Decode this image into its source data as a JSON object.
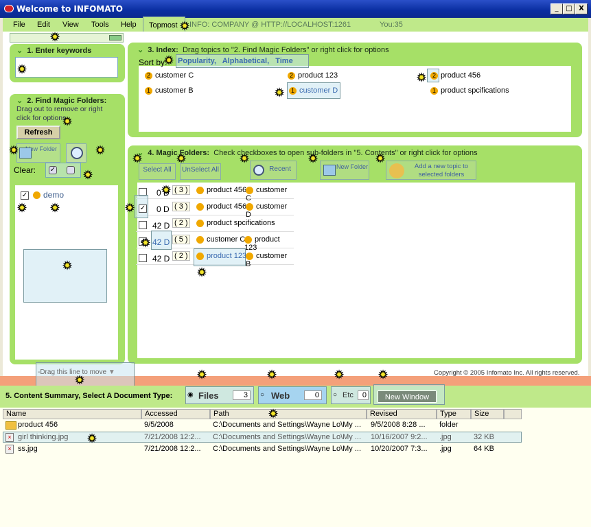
{
  "window": {
    "title": "Welcome to INFOMATO",
    "minimize": "_",
    "maximize": "□",
    "close": "X"
  },
  "menu": {
    "file": "File",
    "edit": "Edit",
    "view": "View",
    "tools": "Tools",
    "help": "Help",
    "topmost": "Topmost",
    "info": "INFO:   COMPANY @ HTTP://LOCALHOST:1261",
    "you": "You:35"
  },
  "panel1": {
    "title": "1. Enter keywords"
  },
  "panel2": {
    "title": "2. Find Magic Folders:",
    "hint": "Drag out to remove or right click for options",
    "refresh": "Refresh",
    "new_folder": "New Folder",
    "clear": "Clear:",
    "folder_name": "demo"
  },
  "panel3": {
    "title": "3. Index:",
    "hint": "Drag topics to \"2. Find Magic Folders\" or right click for options",
    "sort_by": "Sort by:",
    "sort_popularity": "Popularity,",
    "sort_alpha": "Alphabetical,",
    "sort_time": "Time",
    "topics": [
      {
        "count": "2",
        "name": "customer C"
      },
      {
        "count": "2",
        "name": "product 123"
      },
      {
        "count": "2",
        "name": "product 456"
      },
      {
        "count": "1",
        "name": "customer B"
      },
      {
        "count": "1",
        "name": "customer D"
      },
      {
        "count": "1",
        "name": "product spcifications"
      }
    ]
  },
  "panel4": {
    "title": "4. Magic Folders:",
    "hint": "Check checkboxes to open sub-folders in \"5. Contents\" or right click for options",
    "select_all": "Select All",
    "unselect_all": "UnSelect All",
    "recent": "Recent",
    "new_folder": "New Folder",
    "add_topic": "Add a new topic to selected folders",
    "rows": [
      {
        "checked": false,
        "age": "0 D",
        "count": "( 3 )",
        "tags": [
          "product 456",
          "customer C"
        ]
      },
      {
        "checked": true,
        "age": "0 D",
        "count": "( 3 )",
        "tags": [
          "product 456",
          "customer D"
        ]
      },
      {
        "checked": false,
        "age": "42 D",
        "count": "( 2 )",
        "tags": [
          "product spcifications"
        ]
      },
      {
        "checked": true,
        "age": "42 D",
        "count": "( 5 )",
        "tags": [
          "customer C",
          "product 123"
        ]
      },
      {
        "checked": false,
        "age": "42 D",
        "count": "( 2 )",
        "tags": [
          "product 123",
          "customer B"
        ]
      }
    ]
  },
  "copyright": "Copyright © 2005 Infomato Inc. All rights reserved.",
  "drag_line": "-Drag this line to move",
  "content": {
    "title": "5.  Content Summary, Select A Document Type:",
    "files": "Files",
    "files_count": "3",
    "web": "Web",
    "web_count": "0",
    "etc": "Etc",
    "etc_count": "0",
    "new_window": "New Window"
  },
  "table": {
    "headers": [
      "Name",
      "Accessed",
      "Path",
      "Revised",
      "Type",
      "Size"
    ],
    "rows": [
      {
        "name": "product 456",
        "accessed": "9/5/2008",
        "path": "C:\\Documents and Settings\\Wayne Lo\\My ...",
        "revised": "9/5/2008 8:28 ...",
        "type": "folder",
        "size": ""
      },
      {
        "name": "girl thinking.jpg",
        "accessed": "7/21/2008 12:2...",
        "path": "C:\\Documents and Settings\\Wayne Lo\\My ...",
        "revised": "10/16/2007 9:2...",
        "type": ".jpg",
        "size": "32 KB"
      },
      {
        "name": "ss.jpg",
        "accessed": "7/21/2008 12:2...",
        "path": "C:\\Documents and Settings\\Wayne Lo\\My ...",
        "revised": "10/20/2007 7:3...",
        "type": ".jpg",
        "size": "64 KB"
      }
    ]
  }
}
